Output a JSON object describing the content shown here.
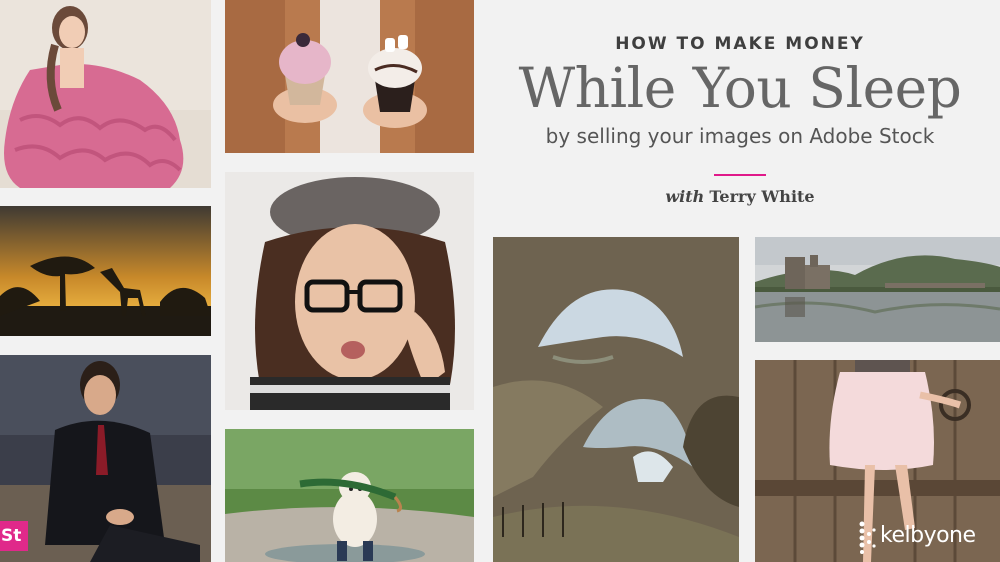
{
  "title": {
    "kicker": "HOW TO MAKE MONEY",
    "headline": "While You Sleep",
    "subtitle": "by selling your images on Adobe Stock",
    "byline_prefix": "with",
    "byline_name": "Terry White"
  },
  "badge": {
    "label": "St"
  },
  "logo": {
    "text": "kelbyone"
  },
  "colors": {
    "accent": "#e0198a",
    "background": "#f2f2f2"
  }
}
